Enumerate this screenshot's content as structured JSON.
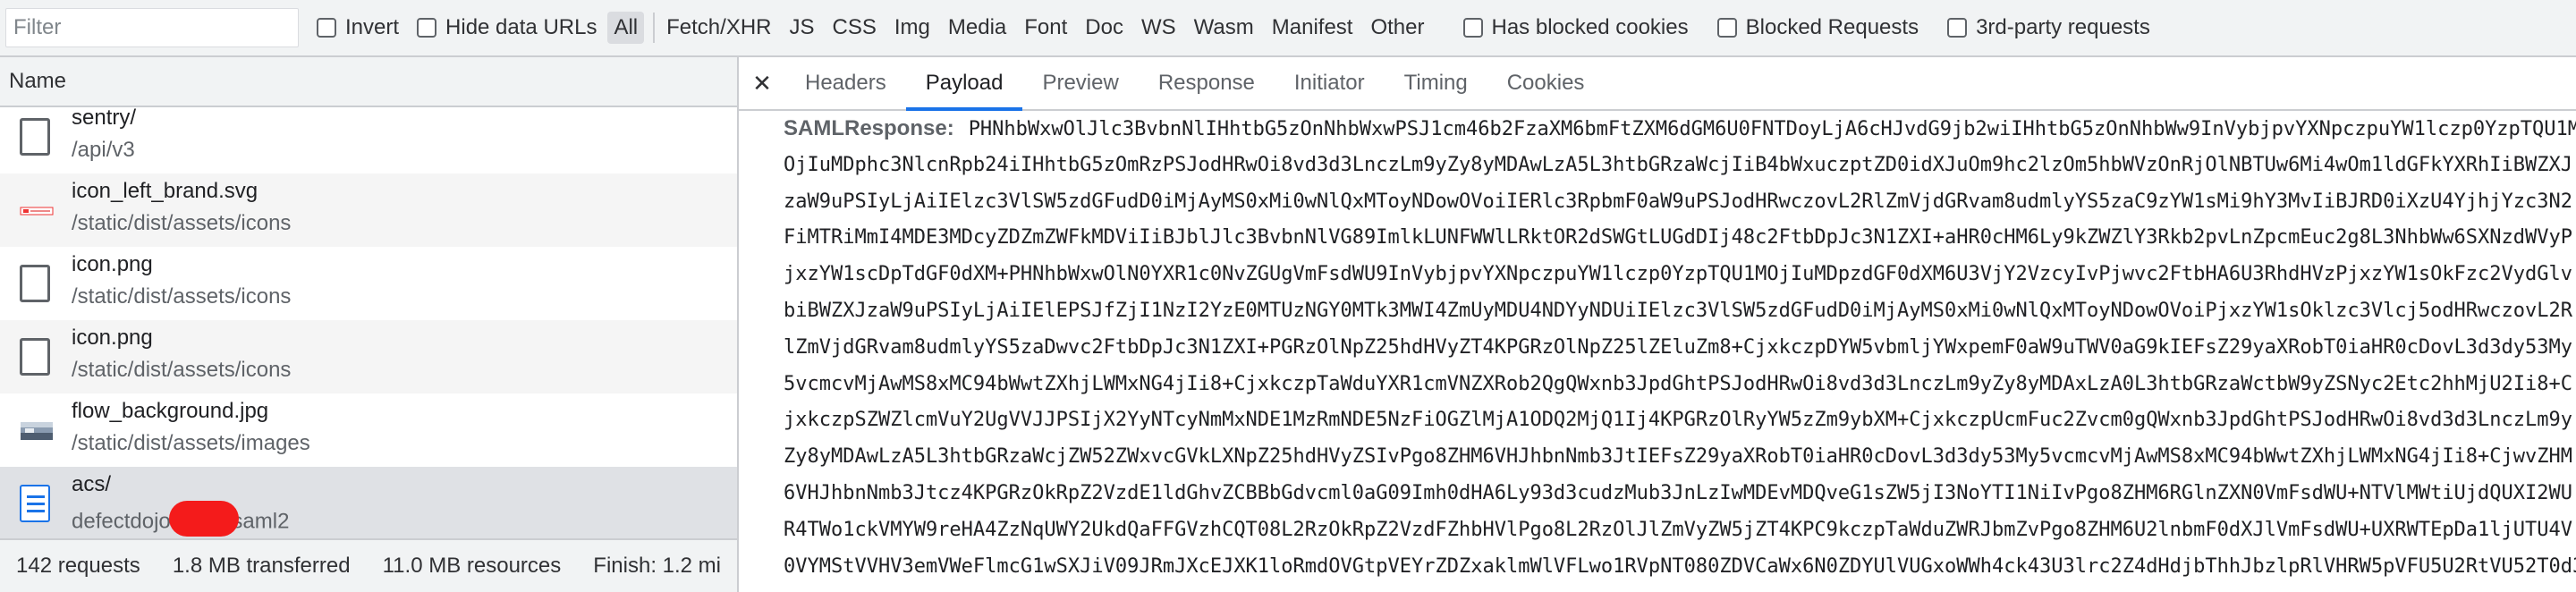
{
  "filter": {
    "placeholder": "Filter"
  },
  "options": {
    "invert": "Invert",
    "hide_data_urls": "Hide data URLs",
    "has_blocked_cookies": "Has blocked cookies",
    "blocked_requests": "Blocked Requests",
    "third_party": "3rd-party requests"
  },
  "types": [
    "All",
    "Fetch/XHR",
    "JS",
    "CSS",
    "Img",
    "Media",
    "Font",
    "Doc",
    "WS",
    "Wasm",
    "Manifest",
    "Other"
  ],
  "list": {
    "header": "Name",
    "requests": [
      {
        "name": "sentry/",
        "path": "/api/v3",
        "icon": "file-icon"
      },
      {
        "name": "icon_left_brand.svg",
        "path": "/static/dist/assets/icons",
        "icon": "brand-logo-icon"
      },
      {
        "name": "icon.png",
        "path": "/static/dist/assets/icons",
        "icon": "file-icon"
      },
      {
        "name": "icon.png",
        "path": "/static/dist/assets/icons",
        "icon": "file-icon"
      },
      {
        "name": "flow_background.jpg",
        "path": "/static/dist/assets/images",
        "icon": "image-thumbnail-icon"
      },
      {
        "name": "acs/",
        "path_prefix": "defectdojo.",
        "path_suffix": "saml2",
        "icon": "document-icon"
      }
    ]
  },
  "status": {
    "requests": "142 requests",
    "transferred": "1.8 MB transferred",
    "resources": "11.0 MB resources",
    "finish": "Finish: 1.2 mi"
  },
  "tabs": [
    "Headers",
    "Payload",
    "Preview",
    "Response",
    "Initiator",
    "Timing",
    "Cookies"
  ],
  "active_tab": "Payload",
  "payload": {
    "key": "SAMLResponse:",
    "lines": [
      "PHNhbWxwOlJlc3BvbnNlIHhtbG5zOnNhbWxwPSJ1cm46b2FzaXM6bmFtZXM6dGM6U0FNTDoyLjA6cHJvdG9jb2wiIHhtbG5zOnNhbWw9InVybjpvYXNpczpuYW1lczp0YzpTQU1M",
      "OjIuMDphc3NlcnRpb24iIHhtbG5zOmRzPSJodHRwOi8vd3d3LnczLm9yZy8yMDAwLzA5L3htbGRzaWcjIiB4bWxuczptZD0idXJuOm9hc2lzOm5hbWVzOnRjOlNBTUw6Mi4wOm1ldGFkYXRhIiBWZXJ",
      "zaW9uPSIyLjAiIElzc3VlSW5zdGFudD0iMjAyMS0xMi0wNlQxMToyNDowOVoiIERlc3RpbmF0aW9uPSJodHRwczovL2RlZmVjdGRvam8udmlyYS5zaC9zYW1sMi9hY3MvIiBJRD0iXzU4YjhjYzc3N2",
      "FiMTRiMmI4MDE3MDcyZDZmZWFkMDViIiBJblJlc3BvbnNlVG89ImlkLUNFWWlLRktOR2dSWGtLUGdDIj48c2FtbDpJc3N1ZXI+aHR0cHM6Ly9kZWZlY3Rkb2pvLnZpcmEuc2g8L3NhbWw6SXNzdWVyP",
      "jxzYW1scDpTdGF0dXM+PHNhbWxwOlN0YXR1c0NvZGUgVmFsdWU9InVybjpvYXNpczpuYW1lczp0YzpTQU1MOjIuMDpzdGF0dXM6U3VjY2VzcyIvPjwvc2FtbHA6U3RhdHVzPjxzYW1sOkFzc2VydGlv",
      "biBWZXJzaW9uPSIyLjAiIElEPSJfZjI1NzI2YzE0MTUzNGY0MTk3MWI4ZmUyMDU4NDYyNDUiIElzc3VlSW5zdGFudD0iMjAyMS0xMi0wNlQxMToyNDowOVoiPjxzYW1sOklzc3Vlcj5odHRwczovL2R",
      "lZmVjdGRvam8udmlyYS5zaDwvc2FtbDpJc3N1ZXI+PGRzOlNpZ25hdHVyZT4KPGRzOlNpZ25lZEluZm8+CjxkczpDYW5vbmljYWxpemF0aW9uTWV0aG9kIEFsZ29yaXRobT0iaHR0cDovL3d3dy53My",
      "5vcmcvMjAwMS8xMC94bWwtZXhjLWMxNG4jIi8+CjxkczpTaWduYXR1cmVNZXRob2QgQWxnb3JpdGhtPSJodHRwOi8vd3d3LnczLm9yZy8yMDAxLzA0L3htbGRzaWctbW9yZSNyc2Etc2hhMjU2Ii8+C",
      "jxkczpSZWZlcmVuY2UgVVJJPSIjX2YyNTcyNmMxNDE1MzRmNDE5NzFiOGZlMjA1ODQ2MjQ1Ij4KPGRzOlRyYW5zZm9ybXM+CjxkczpUcmFuc2Zvcm0gQWxnb3JpdGhtPSJodHRwOi8vd3d3LnczLm9y",
      "Zy8yMDAwLzA5L3htbGRzaWcjZW52ZWxvcGVkLXNpZ25hdHVyZSIvPgo8ZHM6VHJhbnNmb3JtIEFsZ29yaXRobT0iaHR0cDovL3d3dy53My5vcmcvMjAwMS8xMC94bWwtZXhjLWMxNG4jIi8+CjwvZHM",
      "6VHJhbnNmb3Jtcz4KPGRzOkRpZ2VzdE1ldGhvZCBBbGdvcml0aG09Imh0dHA6Ly93d3cudzMub3JnLzIwMDEvMDQveG1sZW5jI3NoYTI1NiIvPgo8ZHM6RGlnZXN0VmFsdWU+NTVlMWtiUjdQUXI2WU",
      "R4TWo1ckVMYW9reHA4ZzNqUWY2UkdQaFFGVzhCQT08L2RzOkRpZ2VzdFZhbHVlPgo8L2RzOlJlZmVyZW5jZT4KPC9kczpTaWduZWRJbmZvPgo8ZHM6U2lnbmF0dXJlVmFsdWU+UXRWTEpDa1ljUTU4V",
      "0VYMStVVHV3emVWeFlmcG1wSXJiV09JRmJXcEJXK1loRmdOVGtpVEYrZDZxaklmWlVFLwo1RVpNT080ZDVCaWx6N0ZDYUlVUGxoWWh4ck43U3lrc2Z4dHdjbThhJbzlpRlVHRW5pVFU5U2RtVU52T0d3"
    ]
  }
}
